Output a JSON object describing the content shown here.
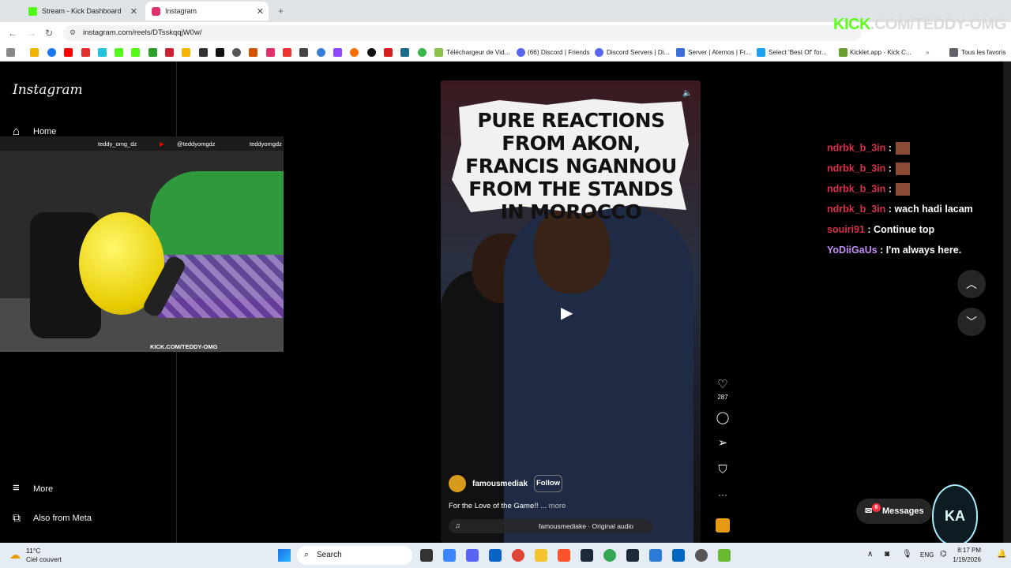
{
  "browser": {
    "tabs": [
      {
        "label": "Stream - Kick Dashboard",
        "color": "#53fc18"
      },
      {
        "label": "Instagram",
        "color": "#e1306c"
      }
    ],
    "url": "instagram.com/reels/DTsskqqjW0w/",
    "bookmarks": [
      "Téléchargeur de Vid...",
      "(66) Discord | Friends",
      "Discord Servers | Di...",
      "Server | Aternos | Fr...",
      "Select 'Best Of' for...",
      "Kicklet.app - Kick C...",
      "Tous les favoris"
    ]
  },
  "instagram": {
    "logo": "Instagram",
    "nav": {
      "home": "Home",
      "more": "More",
      "also_from_meta": "Also from Meta"
    },
    "reel": {
      "title": "PURE REACTIONS FROM AKON, FRANCIS NGANNOU FROM THE STANDS IN MOROCCO",
      "username": "famousmediak",
      "follow": "Follow",
      "caption": "For the Love of the Game!! ...",
      "caption_more": "more",
      "audio": "famousmediake · Original audio",
      "likes": "287"
    },
    "messages": {
      "label": "Messages",
      "badge": "6"
    }
  },
  "webcam": {
    "handles": [
      "teddy_omg_dz",
      "@teddyomgdz",
      "teddyomgdz"
    ],
    "bottom_text": "KICK.COM/TEDDY-OMG"
  },
  "watermark": {
    "brand": "KICK",
    "rest": ".COM/TEDDY-OMG"
  },
  "chat": [
    {
      "user": "ndrbk_b_3in",
      "color": "#d9304a",
      "message": "",
      "emote": true
    },
    {
      "user": "ndrbk_b_3in",
      "color": "#d9304a",
      "message": "",
      "emote": true
    },
    {
      "user": "ndrbk_b_3in",
      "color": "#d9304a",
      "message": "",
      "emote": true
    },
    {
      "user": "ndrbk_b_3in",
      "color": "#d9304a",
      "message": "wach hadi lacam",
      "emote": false
    },
    {
      "user": "souiri91",
      "color": "#d9304a",
      "message": "Continue top",
      "emote": false
    },
    {
      "user": "YoDiiGaUs",
      "color": "#c38cf5",
      "message": "I'm always here.",
      "emote": false
    }
  ],
  "taskbar": {
    "weather_temp": "11°C",
    "weather_desc": "Ciel couvert",
    "search": "Search",
    "lang": "ENG",
    "time": "8:17 PM",
    "date": "1/19/2026"
  }
}
